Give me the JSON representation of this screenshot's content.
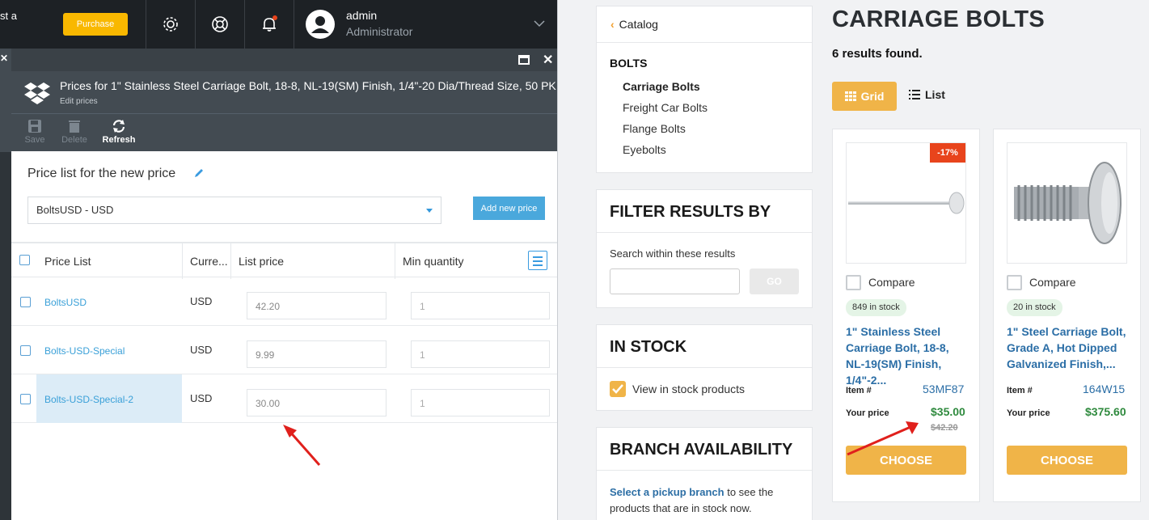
{
  "topbar": {
    "cut_text": "st a",
    "purchase_label": "Purchase",
    "user_name": "admin",
    "user_role": "Administrator"
  },
  "blade": {
    "title": "Prices for 1\" Stainless Steel Carriage Bolt, 18-8, NL-19(SM) Finish, 1/4\"-20 Dia/Thread Size, 50 PK",
    "subtitle": "Edit prices",
    "toolbar": {
      "save": "Save",
      "delete": "Delete",
      "refresh": "Refresh"
    },
    "price_list_label": "Price list for the new price",
    "price_list_value": "BoltsUSD - USD",
    "add_new_price": "Add new price",
    "columns": {
      "price_list": "Price List",
      "currency": "Curre...",
      "list_price": "List price",
      "min_quantity": "Min quantity"
    },
    "rows": [
      {
        "name": "BoltsUSD",
        "currency": "USD",
        "list_price": "42.20",
        "min_qty": "1"
      },
      {
        "name": "Bolts-USD-Special",
        "currency": "USD",
        "list_price": "9.99",
        "min_qty": "1"
      },
      {
        "name": "Bolts-USD-Special-2",
        "currency": "USD",
        "list_price": "30.00",
        "min_qty": "1"
      }
    ]
  },
  "store": {
    "catalog_back": "Catalog",
    "category_heading": "BOLTS",
    "categories": [
      "Carriage Bolts",
      "Freight Car Bolts",
      "Flange Bolts",
      "Eyebolts"
    ],
    "filter_heading": "FILTER RESULTS BY",
    "search_label": "Search within these results",
    "go_label": "GO",
    "instock_heading": "IN STOCK",
    "instock_label": "View in stock products",
    "branch_heading": "BRANCH AVAILABILITY",
    "branch_link": "Select a pickup branch",
    "branch_rest": " to see the products that are in stock now.",
    "page_title": "CARRIAGE BOLTS",
    "results": "6 results found.",
    "grid_label": "Grid",
    "list_label": "List",
    "products": [
      {
        "badge": "-17%",
        "compare": "Compare",
        "stock": "849 in stock",
        "name": "1\" Stainless Steel Carriage Bolt, 18-8, NL-19(SM) Finish, 1/4\"-2...",
        "item_label": "Item #",
        "item_no": "53MF87",
        "price_label": "Your price",
        "price": "$35.00",
        "old_price": "$42.20",
        "choose": "CHOOSE"
      },
      {
        "compare": "Compare",
        "stock": "20 in stock",
        "name": "1\" Steel Carriage Bolt, Grade A, Hot Dipped Galvanized Finish,...",
        "item_label": "Item #",
        "item_no": "164W15",
        "price_label": "Your price",
        "price": "$375.60",
        "choose": "CHOOSE"
      }
    ]
  },
  "colors": {
    "accent": "#f0b448",
    "admin_dark": "#1d2125",
    "blade": "#434b52",
    "link": "#3aa0d8",
    "price_green": "#2f8a3e",
    "annotation_arrow": "#e0201c"
  }
}
